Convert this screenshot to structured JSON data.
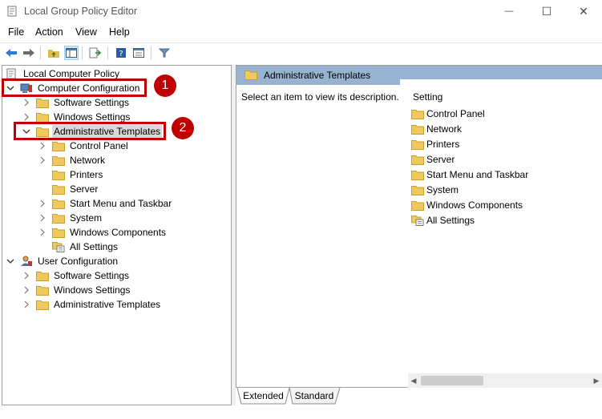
{
  "window": {
    "title": "Local Group Policy Editor",
    "minimize_glyph": "—",
    "maximize_glyph": "☐",
    "close_glyph": "✕"
  },
  "menu": [
    "File",
    "Action",
    "View",
    "Help"
  ],
  "toolbar_icons": [
    "back-arrow-icon",
    "forward-arrow-icon",
    "up-folder-icon",
    "show-hide-tree-icon",
    "export-list-icon",
    "help-icon",
    "properties-icon",
    "filter-icon"
  ],
  "tree": {
    "root": "Local Computer Policy",
    "computer_configuration": "Computer Configuration",
    "software_settings": "Software Settings",
    "windows_settings": "Windows Settings",
    "administrative_templates": "Administrative Templates",
    "children": [
      "Control Panel",
      "Network",
      "Printers",
      "Server",
      "Start Menu and Taskbar",
      "System",
      "Windows Components",
      "All Settings"
    ],
    "user_configuration": "User Configuration",
    "user_software_settings": "Software Settings",
    "user_windows_settings": "Windows Settings",
    "user_administrative_templates": "Administrative Templates"
  },
  "callouts": [
    "1",
    "2"
  ],
  "right_pane": {
    "header": "Administrative Templates",
    "description": "Select an item to view its description.",
    "column_header": "Setting",
    "items": [
      "Control Panel",
      "Network",
      "Printers",
      "Server",
      "Start Menu and Taskbar",
      "System",
      "Windows Components",
      "All Settings"
    ]
  },
  "tabs": [
    "Extended",
    "Standard"
  ],
  "colors": {
    "highlight": "#c00000",
    "pane_header": "#97b3cf",
    "folder": "#f0c95c"
  }
}
